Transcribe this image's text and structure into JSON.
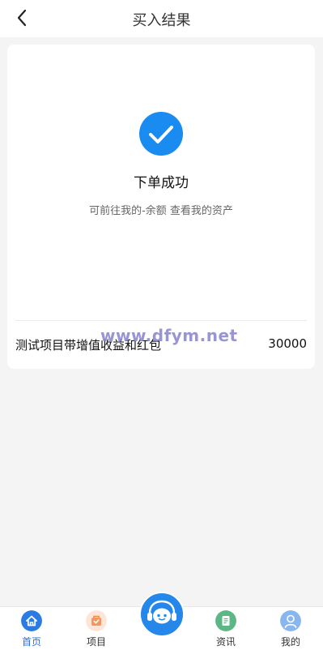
{
  "header": {
    "title": "买入结果"
  },
  "result": {
    "title": "下单成功",
    "description": "可前往我的-余额 查看我的资产"
  },
  "order": {
    "name": "测试项目带增值收益和红包",
    "amount": "30000"
  },
  "watermark": "www.dfym.net",
  "tabbar": {
    "items": [
      {
        "label": "首页",
        "icon": "home-icon",
        "color": "#2b7be5"
      },
      {
        "label": "项目",
        "icon": "project-bag-icon",
        "color": "#f6a36c"
      },
      {
        "label": "资讯",
        "icon": "news-document-icon",
        "color": "#5db785"
      },
      {
        "label": "我的",
        "icon": "user-avatar-icon",
        "color": "#8ab6ef"
      }
    ],
    "center": {
      "icon": "customer-service-icon",
      "color": "#2487e9"
    }
  },
  "colors": {
    "accent": "#1a8bf0",
    "background": "#f4f4f4"
  }
}
